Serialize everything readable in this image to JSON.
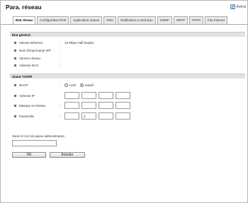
{
  "header": {
    "title": "Para. réseau",
    "refresh_label": "Refrai"
  },
  "tabs": [
    {
      "label": "État réseau",
      "active": true
    },
    {
      "label": "Configuration IPv6",
      "active": false
    },
    {
      "label": "Application réseau",
      "active": false
    },
    {
      "label": "DNS",
      "active": false
    },
    {
      "label": "Notification e-mail auto",
      "active": false
    },
    {
      "label": "SNMP",
      "active": false
    },
    {
      "label": "SMTP",
      "active": false
    },
    {
      "label": "POP3",
      "active": false
    },
    {
      "label": "Fax Internet",
      "active": false
    }
  ],
  "general": {
    "heading": "État général",
    "rows": [
      {
        "label": "Vitesse Ethernet",
        "value": "10 Mbps Half Duplex"
      },
      {
        "label": "Nom d'imprimante IPP",
        "value": ""
      },
      {
        "label": "Version réseau",
        "value": ""
      },
      {
        "label": "Adresse MAC",
        "value": ""
      }
    ]
  },
  "tcpip": {
    "heading": "Statut TCP/IP",
    "dhcp": {
      "label": "DHCP",
      "option_on": "Actif",
      "option_off": "Inactif",
      "selected": "Inactif"
    },
    "ip_label": "Adresse IP",
    "ip": [
      "",
      "",
      "",
      ""
    ],
    "mask_label": "Masque ss-réseau",
    "mask": [
      "",
      "",
      "",
      ""
    ],
    "gateway_label": "Passerelle",
    "gateway": [
      "",
      "1",
      "",
      ""
    ]
  },
  "password": {
    "label": "Saisir le mot de passe administrateur.",
    "value": ""
  },
  "buttons": {
    "ok": "OK",
    "cancel": "Annuler"
  }
}
